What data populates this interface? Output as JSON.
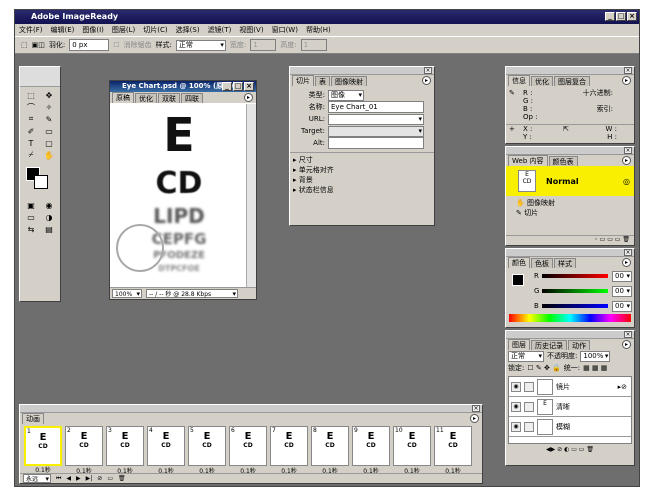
{
  "app": {
    "title": "Adobe ImageReady"
  },
  "menu": [
    "文件(F)",
    "编辑(E)",
    "图像(I)",
    "图层(L)",
    "切片(C)",
    "选择(S)",
    "滤镜(T)",
    "视图(V)",
    "窗口(W)",
    "帮助(H)"
  ],
  "options": {
    "feather_label": "羽化:",
    "feather_value": "0 px",
    "antialias_label": "消除锯齿",
    "style_label": "样式:",
    "style_value": "正常",
    "width_label": "宽度:",
    "width_value": "1",
    "height_label": "高度:",
    "height_value": "1"
  },
  "document": {
    "title": "Eye Chart.psd @ 100% (原稿)",
    "tabs": [
      "原稿",
      "优化",
      "双联",
      "四联"
    ],
    "chart_lines": [
      "E",
      "CD",
      "LIPD",
      "CEPFG",
      "PFODEZE",
      "DTPCFOE"
    ],
    "status_zoom": "100%",
    "status_info": "-- / -- 秒 @ 28.8 Kbps"
  },
  "slice_panel": {
    "tabs": [
      "切片",
      "表",
      "图像映射"
    ],
    "type_label": "类型:",
    "type_value": "图像",
    "name_label": "名称:",
    "name_value": "Eye Chart_01",
    "url_label": "URL:",
    "target_label": "Target:",
    "alt_label": "Alt:",
    "sections": [
      "尺寸",
      "单元格对齐",
      "背景",
      "状态栏信息"
    ]
  },
  "info_panel": {
    "tabs": [
      "信息",
      "优化",
      "图层复合"
    ],
    "rgb": [
      "R :",
      "G :",
      "B :",
      "Op :"
    ],
    "hex_label": "十六进制:",
    "index_label": "索引:",
    "xy": [
      "X :",
      "Y :"
    ],
    "wh": [
      "W :",
      "H :"
    ]
  },
  "web_panel": {
    "tabs": [
      "Web 内容",
      "颜色表"
    ],
    "state": "Normal",
    "items": [
      "图像映射",
      "切片"
    ]
  },
  "color_panel": {
    "tabs": [
      "颜色",
      "色板",
      "样式"
    ],
    "labels": [
      "R",
      "G",
      "B"
    ],
    "values": [
      "00",
      "00",
      "00"
    ]
  },
  "layers_panel": {
    "tabs": [
      "图层",
      "历史记录",
      "动作"
    ],
    "blend": "正常",
    "opacity_label": "不透明度:",
    "opacity": "100%",
    "lock_label": "锁定:",
    "unify_label": "统一:",
    "layers": [
      "镜片",
      "清晰",
      "模糊"
    ]
  },
  "animation": {
    "tab": "动画",
    "frames": [
      "1",
      "2",
      "3",
      "4",
      "5",
      "6",
      "7",
      "8",
      "9",
      "10",
      "11"
    ],
    "delays": [
      "0.1秒",
      "0.1秒",
      "0.1秒",
      "0.1秒",
      "0.1秒",
      "0.1秒",
      "0.1秒",
      "0.1秒",
      "0.1秒",
      "0.1秒",
      "0.1秒"
    ],
    "loop": "永远"
  }
}
